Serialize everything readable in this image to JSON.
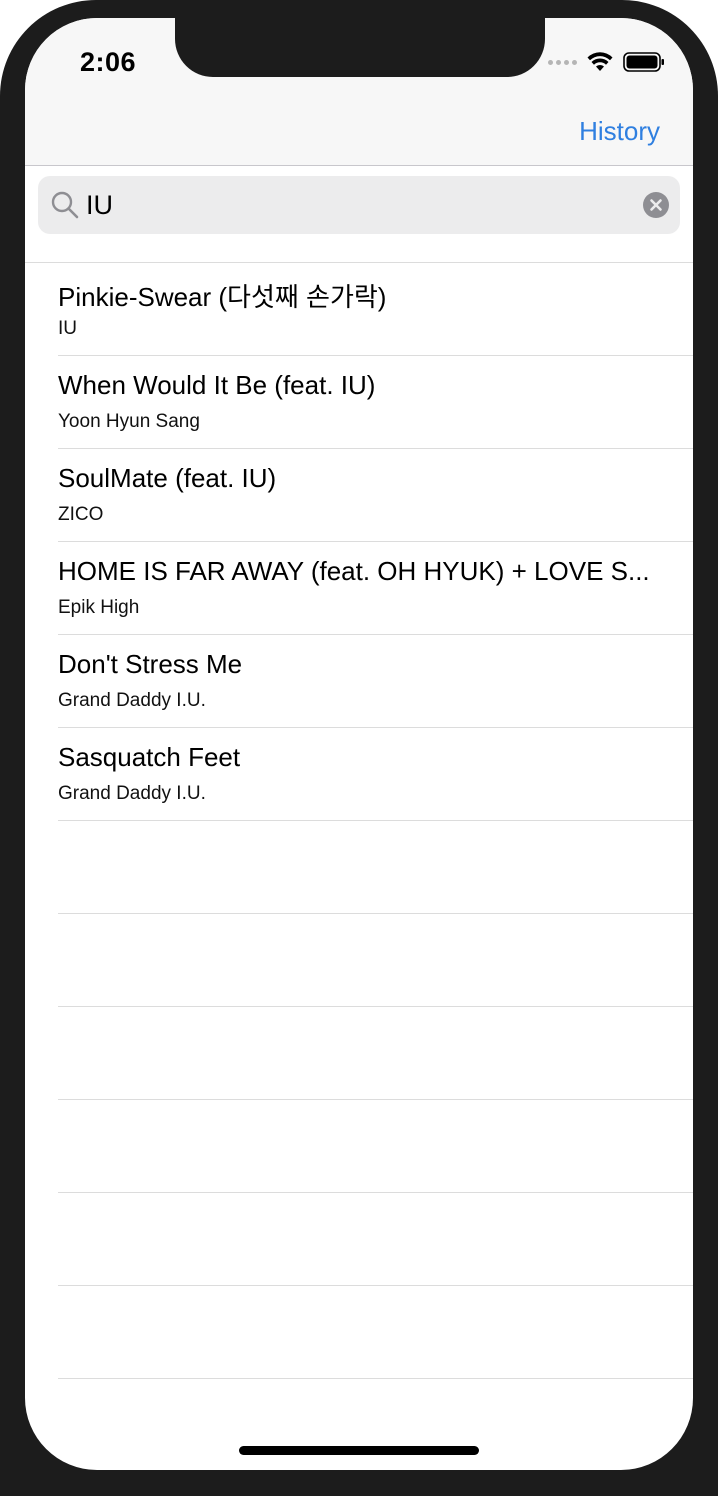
{
  "status_bar": {
    "time": "2:06",
    "icons": [
      "cellular-dots-icon",
      "wifi-icon",
      "battery-icon"
    ]
  },
  "nav_bar": {
    "history_label": "History"
  },
  "search": {
    "value": "IU",
    "placeholder": "",
    "icon": "search-icon",
    "clear_icon": "clear-icon"
  },
  "results": [
    {
      "title": "Pinkie-Swear (다섯째 손가락)",
      "artist": "IU"
    },
    {
      "title": "When Would It Be (feat. IU)",
      "artist": "Yoon Hyun Sang"
    },
    {
      "title": "SoulMate (feat. IU)",
      "artist": "ZICO"
    },
    {
      "title": "HOME IS FAR AWAY (feat. OH HYUK) + LOVE S...",
      "artist": "Epik High"
    },
    {
      "title": "Don't Stress Me",
      "artist": "Grand Daddy I.U."
    },
    {
      "title": "Sasquatch Feet",
      "artist": "Grand Daddy I.U."
    }
  ],
  "colors": {
    "accent": "#2f7fe0",
    "bezel": "#1c1c1c",
    "nav_background": "#f7f7f7",
    "search_field": "#ececed",
    "separator": "#dcdcdc"
  }
}
